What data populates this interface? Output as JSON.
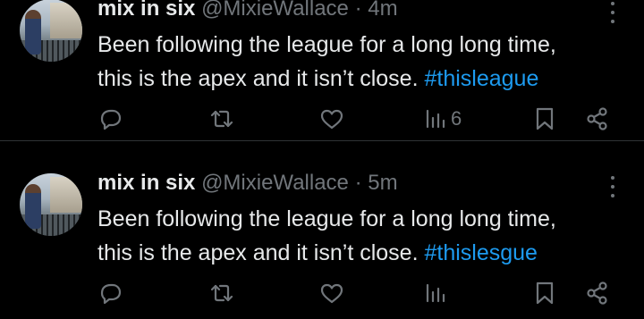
{
  "tweets": [
    {
      "display_name": "mix in six",
      "handle": "@MixieWallace",
      "separator": "·",
      "time": "4m",
      "text_line1": "Been following the league for a long long time,",
      "text_line2_prefix": "this is the apex and it isn’t close. ",
      "hashtag": "#thisleague",
      "views_count": "6"
    },
    {
      "display_name": "mix in six",
      "handle": "@MixieWallace",
      "separator": "·",
      "time": "5m",
      "text_line1": "Been following the league for a long long time,",
      "text_line2_prefix": "this is the apex and it isn’t close. ",
      "hashtag": "#thislesgue",
      "views_count": ""
    }
  ],
  "colors": {
    "background": "#000000",
    "text_primary": "#e7e9ea",
    "text_secondary": "#71767b",
    "accent_link": "#1d9bf0",
    "divider": "#2f3336"
  },
  "icons": [
    "reply-icon",
    "retweet-icon",
    "like-icon",
    "views-icon",
    "bookmark-icon",
    "share-icon",
    "more-icon"
  ]
}
